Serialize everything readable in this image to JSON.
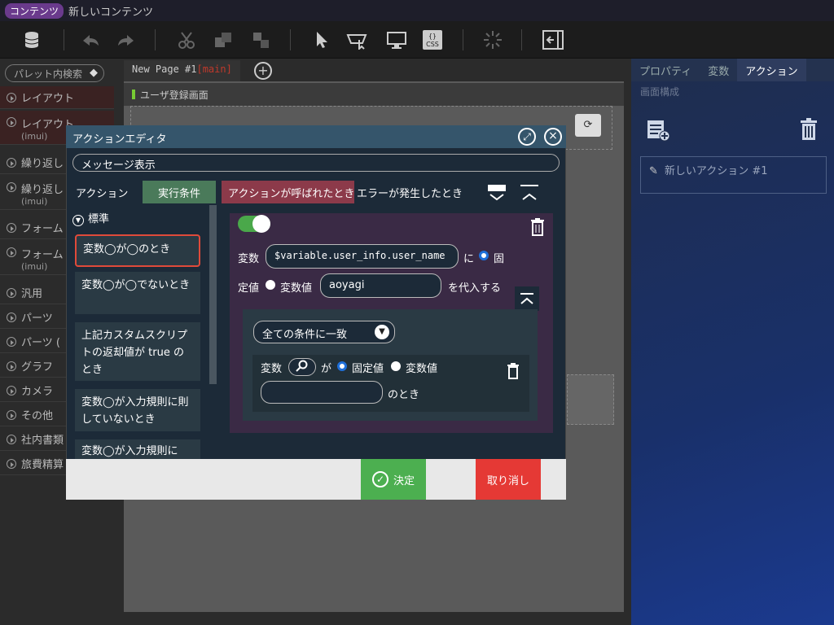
{
  "titlebar": {
    "badge": "コンテンツ",
    "title": "新しいコンテンツ"
  },
  "palette": {
    "search_placeholder": "パレット内検索",
    "categories": [
      "レイアウト",
      "レイアウト",
      "(imui)",
      "繰り返し",
      "繰り返し",
      "(imui)",
      "フォーム",
      "フォーム",
      "(imui)",
      "汎用",
      "パーツ",
      "パーツ (",
      "グラフ",
      "カメラ",
      "その他",
      "社内書類",
      "旅費精算"
    ]
  },
  "page_tab": {
    "label": "New Page #1",
    "marker": "[main]"
  },
  "canvas": {
    "screen_title": "ユーザ登録画面"
  },
  "right": {
    "tabs": [
      "プロパティ",
      "変数",
      "アクション"
    ],
    "sub": "画面構成",
    "new_action": "新しいアクション #1"
  },
  "modal": {
    "title": "アクションエディタ",
    "action_name": "メッセージ表示",
    "tabs": [
      "アクション",
      "実行条件",
      "アクションが呼ばれたとき",
      "エラーが発生したとき"
    ],
    "section": "標準",
    "conditions": [
      "変数◯が◯のとき",
      "変数◯が◯でないとき",
      "上記カスタムスクリプトの返却値が true のとき",
      "変数◯が入力規則に則していないとき",
      "変数◯が入力規則に"
    ],
    "editor": {
      "var_label": "変数",
      "var_value": "$variable.user_info.user_name",
      "ni": "に",
      "fixed": "固",
      "fixed_full": "定値",
      "var_val": "変数値",
      "value": "aoyagi",
      "assign": "を代入する",
      "match": "全ての条件に一致",
      "row_var": "変数",
      "ga": "が",
      "row_fixed": "固定値",
      "row_varval": "変数値",
      "toki": "のとき"
    },
    "ok": "決定",
    "cancel": "取り消し"
  }
}
